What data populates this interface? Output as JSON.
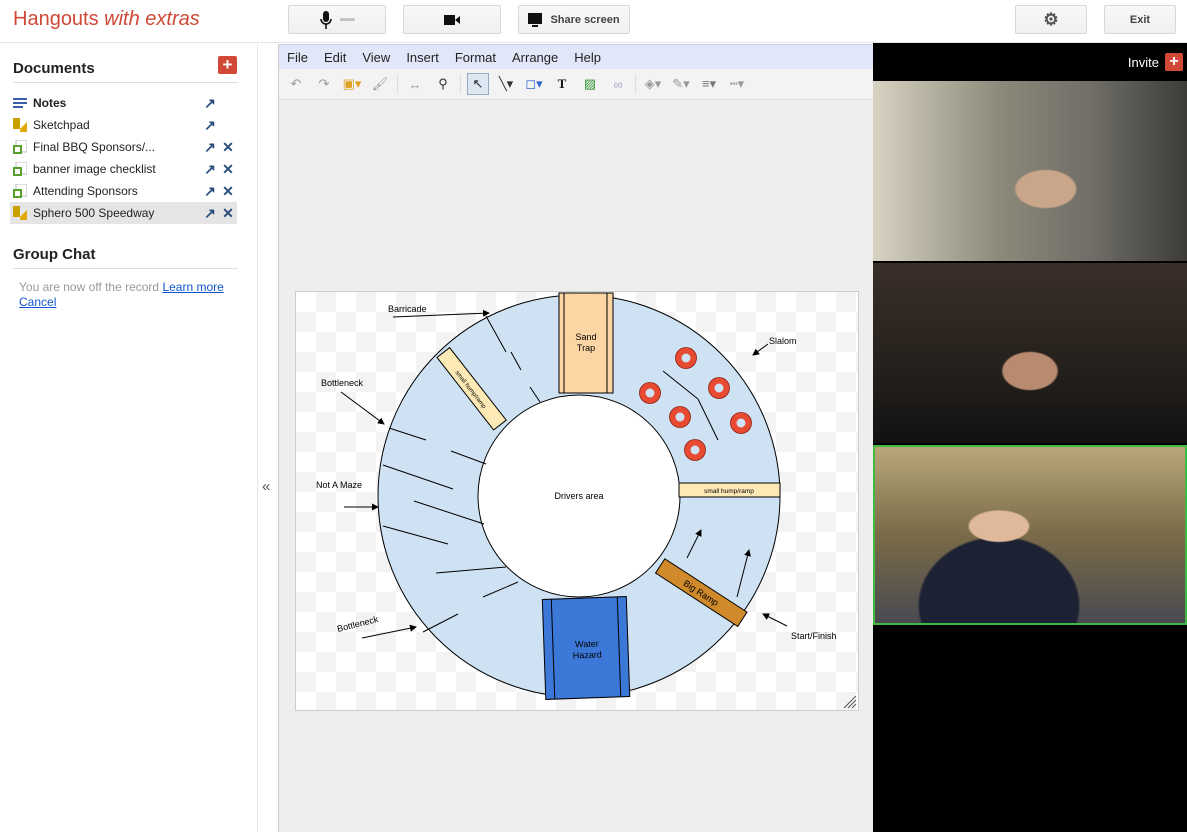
{
  "app": {
    "title_main": "Hangouts ",
    "title_em": "with extras"
  },
  "topbar": {
    "mic_level": "▪▪▪▪▪",
    "share_screen": "Share screen",
    "exit": "Exit"
  },
  "documents": {
    "title": "Documents",
    "add": "+",
    "items": [
      {
        "label": "Notes",
        "type": "notes",
        "removable": false
      },
      {
        "label": "Sketchpad",
        "type": "drawing",
        "removable": false
      },
      {
        "label": "Final BBQ Sponsors/...",
        "type": "spreadsheet",
        "removable": true
      },
      {
        "label": "banner image checklist",
        "type": "spreadsheet",
        "removable": true
      },
      {
        "label": "Attending Sponsors",
        "type": "spreadsheet",
        "removable": true
      },
      {
        "label": "Sphero 500 Speedway",
        "type": "drawing",
        "removable": true,
        "selected": true
      }
    ]
  },
  "chat": {
    "title": "Group Chat",
    "message": "You are now off the record ",
    "learn_more": "Learn more",
    "cancel": "Cancel"
  },
  "collapse": "«",
  "editor": {
    "menu": [
      "File",
      "Edit",
      "View",
      "Insert",
      "Format",
      "Arrange",
      "Help"
    ],
    "tools": [
      "undo-icon",
      "redo-icon",
      "insert-image-icon",
      "paint-format-icon",
      "fit-icon",
      "zoom-icon",
      "select-icon",
      "line-icon",
      "shape-icon",
      "text-box-icon",
      "image-icon",
      "link-icon",
      "fill-color-icon",
      "line-color-icon",
      "line-weight-icon",
      "line-dash-icon"
    ]
  },
  "diagram": {
    "labels": {
      "barricade": "Barricade",
      "bottleneck_top": "Bottleneck",
      "not_a_maze": "Not A Maze",
      "bottleneck_bottom": "Bottleneck",
      "slalom": "Slalom",
      "start_finish": "Start/Finish",
      "drivers_area": "Drivers area",
      "sand_trap_1": "Sand",
      "sand_trap_2": "Trap",
      "water_1": "Water",
      "water_2": "Hazard",
      "big_ramp": "Big Ramp",
      "hump_1": "small hump/ramp",
      "hump_2": "small hump/ramp"
    },
    "colors": {
      "track": "#cfe2f3",
      "sand": "#fcd5a5",
      "water": "#3c78d8",
      "ramp": "#d08a2b",
      "hump": "#fde9b5",
      "cone": "#e84a32"
    }
  },
  "video": {
    "invite": "Invite",
    "invite_icon": "+",
    "participants": 3,
    "active_color": "#3fba3f"
  }
}
